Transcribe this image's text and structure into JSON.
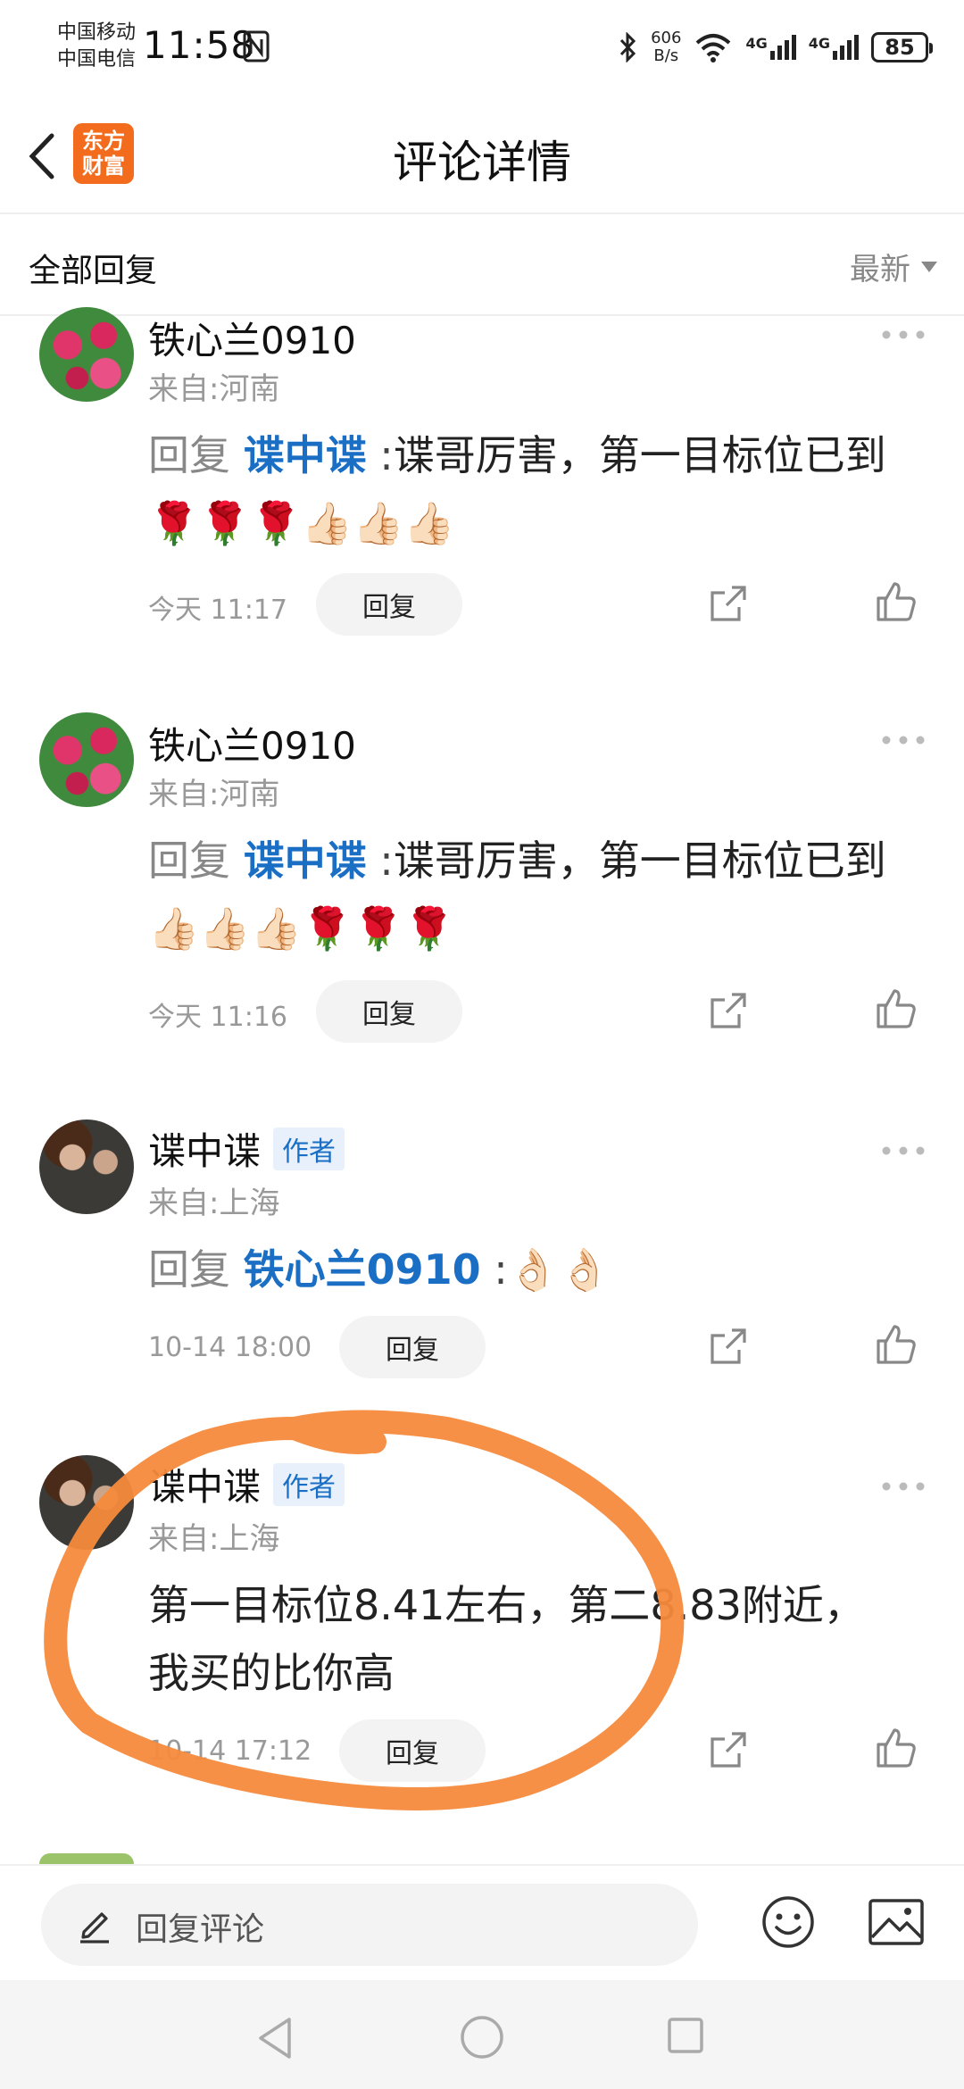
{
  "status_bar": {
    "carrier_1": "中国移动",
    "carrier_2": "中国电信",
    "time": "11:58",
    "net_speed_value": "606",
    "net_speed_unit": "B/s",
    "signal_1": "4G",
    "signal_2": "4G",
    "battery": "85"
  },
  "header": {
    "title": "评论详情",
    "logo_line_1": "东方",
    "logo_line_2": "财富"
  },
  "filter": {
    "title": "全部回复",
    "sort_label": "最新"
  },
  "comments": [
    {
      "username": "铁心兰0910",
      "location": "来自:河南",
      "reply_prefix": "回复",
      "mention": "谍中谍",
      "colon": ":",
      "text": "谍哥厉害，第一目标位已到🌹🌹🌹👍🏻👍🏻👍🏻",
      "time": "今天 11:17",
      "reply_label": "回复"
    },
    {
      "username": "铁心兰0910",
      "location": "来自:河南",
      "reply_prefix": "回复",
      "mention": "谍中谍",
      "colon": ":",
      "text": "谍哥厉害，第一目标位已到👍🏻👍🏻👍🏻🌹🌹🌹",
      "time": "今天 11:16",
      "reply_label": "回复"
    },
    {
      "username": "谍中谍",
      "badge": "作者",
      "location": "来自:上海",
      "reply_prefix": "回复",
      "mention": "铁心兰0910",
      "colon": ":",
      "text": "👌🏻👌🏻",
      "time": "10-14 18:00",
      "reply_label": "回复"
    },
    {
      "username": "谍中谍",
      "badge": "作者",
      "location": "来自:上海",
      "text": "第一目标位8.41左右，第二8.83附近，我买的比你高",
      "time": "10-14 17:12",
      "reply_label": "回复"
    }
  ],
  "input": {
    "placeholder": "回复评论"
  },
  "colors": {
    "accent": "#1a6fc4",
    "brand": "#f36b1c",
    "annotation": "#f58a3c"
  }
}
